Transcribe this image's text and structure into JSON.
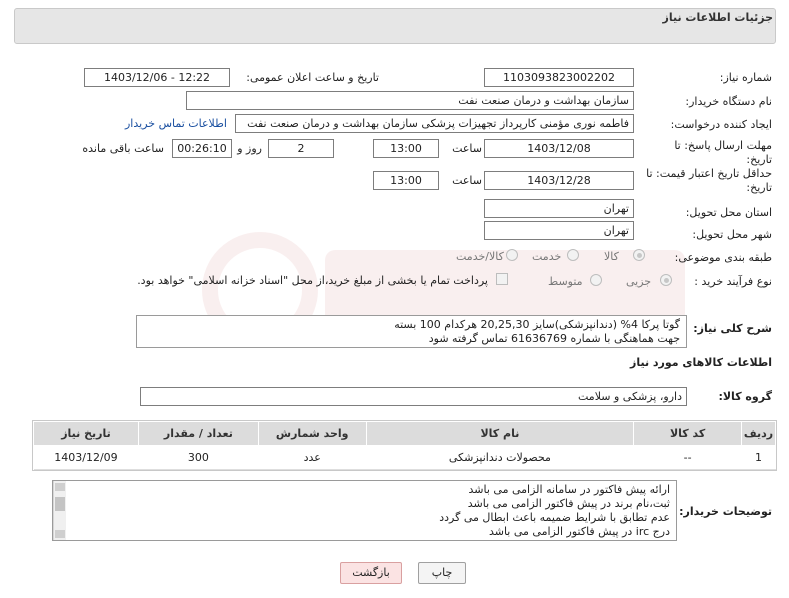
{
  "header": {
    "title": "جزئیات اطلاعات نیاز"
  },
  "fields": {
    "need_number_label": "شماره نیاز:",
    "need_number": "1103093823002202",
    "announce_label": "تاریخ و ساعت اعلان عمومی:",
    "announce_value": "1403/12/06 - 12:22",
    "buyer_org_label": "نام دستگاه خریدار:",
    "buyer_org": "سازمان بهداشت و درمان صنعت نفت",
    "creator_label": "ایجاد کننده درخواست:",
    "creator": "فاطمه نوری مؤمنی کارپرداز تجهیزات پزشکی سازمان بهداشت و درمان صنعت نفت",
    "contact_link": "اطلاعات تماس خریدار",
    "deadline_label_1": "مهلت ارسال پاسخ: تا",
    "deadline_label_2": "تاریخ:",
    "deadline_date": "1403/12/08",
    "time_label": "ساعت",
    "deadline_time": "13:00",
    "days_value": "2",
    "days_label": "روز و",
    "remaining_value": "00:26:10",
    "remaining_label": "ساعت باقی مانده",
    "validity_label_1": "حداقل تاریخ اعتبار قیمت: تا",
    "validity_label_2": "تاریخ:",
    "validity_date": "1403/12/28",
    "validity_time_label": "ساعت",
    "validity_time": "13:00",
    "province_label": "استان محل تحویل:",
    "province": "تهران",
    "city_label": "شهر محل تحویل:",
    "city": "تهران",
    "category_label": "طبقه بندی موضوعی:",
    "category_options": [
      "کالا",
      "خدمت",
      "کالا/خدمت"
    ],
    "process_label": "نوع فرآیند خرید :",
    "process_options": [
      "جزیی",
      "متوسط"
    ],
    "payment_note": "پرداخت تمام یا بخشی از مبلغ خرید،از محل \"اسناد خزانه اسلامی\" خواهد بود."
  },
  "description": {
    "label": "شرح کلی نیاز:",
    "lines": [
      "گوتا پرکا 4% (دندانپزشکی)سایز 20,25,30 هرکدام 100 بسته",
      "جهت هماهنگی با شماره 61636769 تماس گرفته شود"
    ]
  },
  "goods": {
    "section_title": "اطلاعات کالاهای مورد نیاز",
    "group_label": "گروه کالا:",
    "group_value": "دارو، پزشکی و سلامت",
    "columns": [
      "ردیف",
      "کد کالا",
      "نام کالا",
      "واحد شمارش",
      "تعداد / مقدار",
      "تاریخ نیاز"
    ],
    "rows": [
      {
        "row": "1",
        "code": "--",
        "name": "محصولات دندانپزشکی",
        "unit": "عدد",
        "qty": "300",
        "date": "1403/12/09"
      }
    ]
  },
  "buyer_notes": {
    "label": "توضیحات خریدار:",
    "lines": [
      "ارائه پیش فاکتور در سامانه الزامی می باشد",
      "ثبت،نام برند در پیش فاکتور الزامی می باشد",
      "عدم تطابق با شرایط ضمیمه باعث ابطال می گردد",
      "درج irc در پیش فاکتور الزامی می باشد"
    ]
  },
  "buttons": {
    "print": "چاپ",
    "back": "بازگشت"
  }
}
